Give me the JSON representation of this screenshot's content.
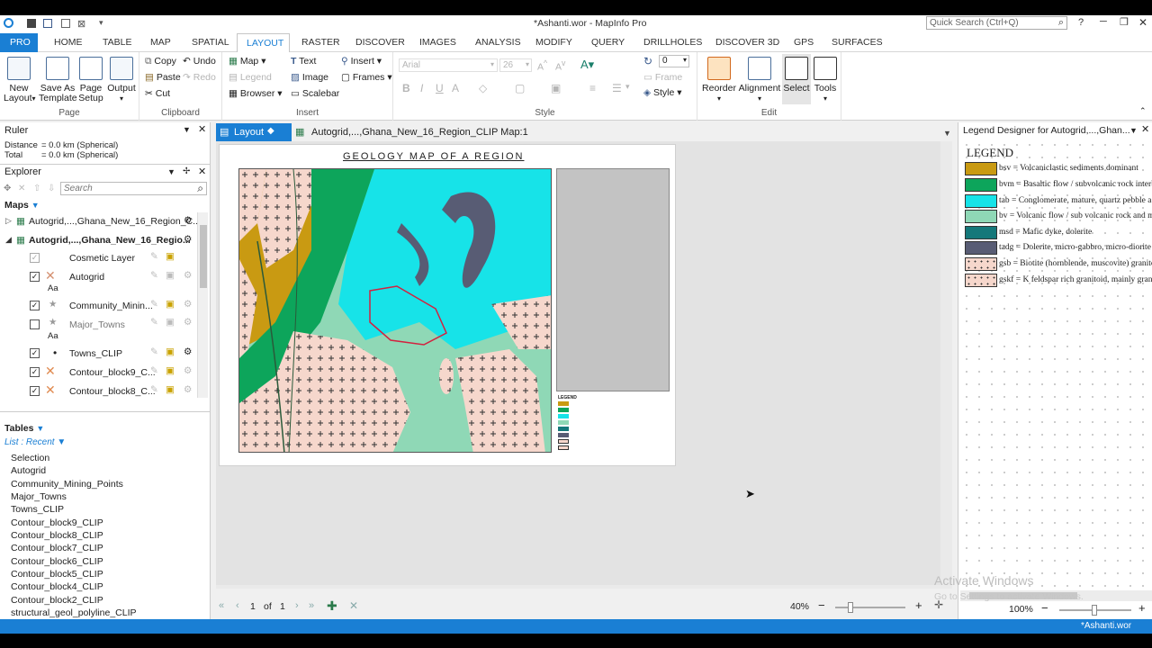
{
  "window": {
    "title": "*Ashanti.wor - MapInfo Pro",
    "quick_search_placeholder": "Quick Search (Ctrl+Q)"
  },
  "ribbon_tabs": [
    "PRO",
    "HOME",
    "TABLE",
    "MAP",
    "SPATIAL",
    "LAYOUT",
    "RASTER",
    "DISCOVER",
    "IMAGES",
    "ANALYSIS",
    "MODIFY",
    "QUERY",
    "DRILLHOLES",
    "DISCOVER 3D",
    "GPS",
    "SURFACES"
  ],
  "active_tab": "LAYOUT",
  "ribbon": {
    "page": {
      "label": "Page",
      "new_layout": "New Layout",
      "save_template": "Save As Template",
      "page_setup": "Page Setup",
      "output": "Output"
    },
    "clipboard": {
      "label": "Clipboard",
      "copy": "Copy",
      "paste": "Paste",
      "cut": "Cut",
      "undo": "Undo",
      "redo": "Redo"
    },
    "insert": {
      "label": "Insert",
      "map": "Map",
      "legend": "Legend",
      "browser": "Browser",
      "text": "Text",
      "image": "Image",
      "scalebar": "Scalebar",
      "insert": "Insert",
      "frames": "Frames"
    },
    "style": {
      "label": "Style",
      "font": "Arial",
      "size": "26",
      "rotation": "0",
      "frame": "Frame",
      "style": "Style"
    },
    "edit": {
      "label": "Edit",
      "reorder": "Reorder",
      "alignment": "Alignment",
      "select": "Select",
      "tools": "Tools"
    }
  },
  "ruler": {
    "title": "Ruler",
    "distance_label": "Distance",
    "distance_value": "= 0.0 km (Spherical)",
    "total_label": "Total",
    "total_value": "= 0.0 km (Spherical)"
  },
  "explorer": {
    "title": "Explorer",
    "search_placeholder": "Search",
    "maps_label": "Maps",
    "map1": "Autogrid,...,Ghana_New_16_Region_C...",
    "map2": "Autogrid,...,Ghana_New_16_Regio...",
    "layers": [
      "Cosmetic Layer",
      "Autogrid",
      "Community_Minin...",
      "Major_Towns",
      "Towns_CLIP",
      "Contour_block9_C...",
      "Contour_block8_C..."
    ],
    "aa": "Aa",
    "tables_label": "Tables",
    "list_recent": "List : Recent",
    "tables": [
      "Selection",
      "Autogrid",
      "Community_Mining_Points",
      "Major_Towns",
      "Towns_CLIP",
      "Contour_block9_CLIP",
      "Contour_block8_CLIP",
      "Contour_block7_CLIP",
      "Contour_block6_CLIP",
      "Contour_block5_CLIP",
      "Contour_block4_CLIP",
      "Contour_block2_CLIP",
      "structural_geol_polyline_CLIP"
    ]
  },
  "doc_tabs": {
    "layout": "Layout",
    "map": "Autogrid,...,Ghana_New_16_Region_CLIP Map:1"
  },
  "layout_page": {
    "map_title": "GEOLOGY MAP OF A REGION",
    "mini_legend_title": "LEGEND"
  },
  "pager": {
    "page": "1",
    "of": "of",
    "total": "1",
    "zoom": "40%"
  },
  "legend_designer": {
    "title": "Legend Designer for Autogrid,...,Ghan...",
    "heading": "LEGEND",
    "items": [
      {
        "text": "bsv = Volcaniclastic sediments dominant",
        "color": "#c99a12"
      },
      {
        "text": "bvm = Basaltic flow / subvolcanic rock interb",
        "color": "#0da55b"
      },
      {
        "text": "tab = Conglomerate, mature, quartz pebble a",
        "color": "#17e3e8"
      },
      {
        "text": "bv = Volcanic flow / sub volcanic rock and m",
        "color": "#8fd8b6"
      },
      {
        "text": "msd = Mafic dyke, dolerite",
        "color": "#15787a"
      },
      {
        "text": "tadg = Dolerite, micro-gabbro, micro-diorite",
        "color": "#585c74"
      },
      {
        "text": "gsb = Biotite (hornblende, muscovite) granito",
        "color": "#f6d7cc"
      },
      {
        "text": "gskf = K feldspar rich granitoid, mainly gran",
        "color": "#f6d7cc"
      }
    ],
    "zoom": "100%"
  },
  "watermark": {
    "line1": "Activate Windows",
    "line2": "Go to Settings to activate Windows."
  },
  "status": {
    "workspace": "*Ashanti.wor"
  }
}
